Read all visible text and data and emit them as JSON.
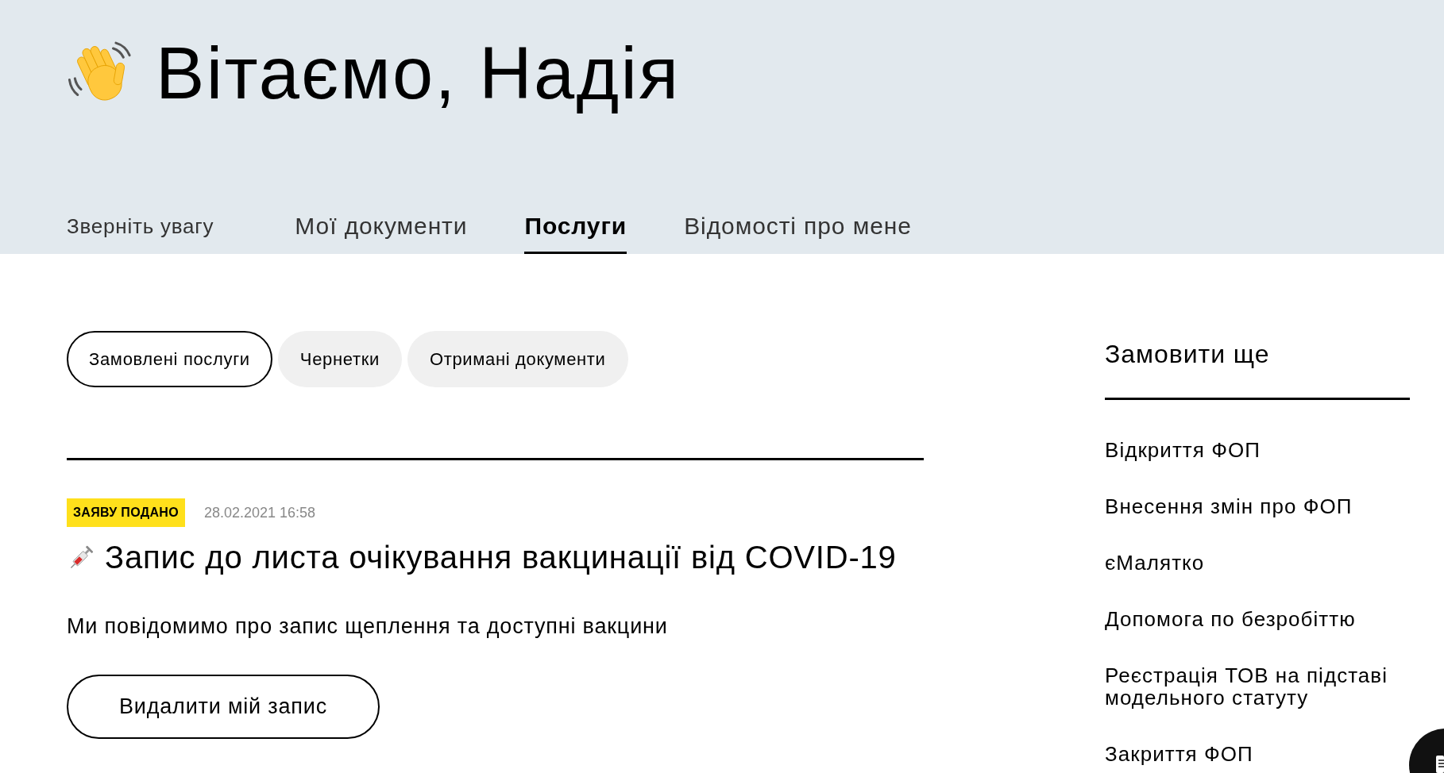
{
  "header": {
    "greeting": "Вітаємо, Надія"
  },
  "tabs": [
    {
      "label": "Зверніть увагу",
      "kind": "note",
      "selected": false
    },
    {
      "label": "Мої документи",
      "kind": "tab",
      "selected": false
    },
    {
      "label": "Послуги",
      "kind": "tab",
      "selected": true
    },
    {
      "label": "Відомості про мене",
      "kind": "tab",
      "selected": false
    }
  ],
  "filters": [
    {
      "label": "Замовлені послуги",
      "selected": true
    },
    {
      "label": "Чернетки",
      "selected": false
    },
    {
      "label": "Отримані документи",
      "selected": false
    }
  ],
  "orders": [
    {
      "status": {
        "label": "ЗАЯВУ ПОДАНО",
        "kind": "submitted"
      },
      "date": "28.02.2021 16:58",
      "title": "Запис до листа очікування вакцинації від COVID-19",
      "description": "Ми повідомимо про запис щеплення та доступні вакцини",
      "action": "Видалити мій запис"
    }
  ],
  "sidebar": {
    "title": "Замовити ще",
    "items": [
      "Відкриття ФОП",
      "Внесення змін про ФОП",
      "єМалятко",
      "Допомога по безробіттю",
      "Реєстрація ТОВ на підставі модельного статуту",
      "Закриття ФОП"
    ]
  }
}
